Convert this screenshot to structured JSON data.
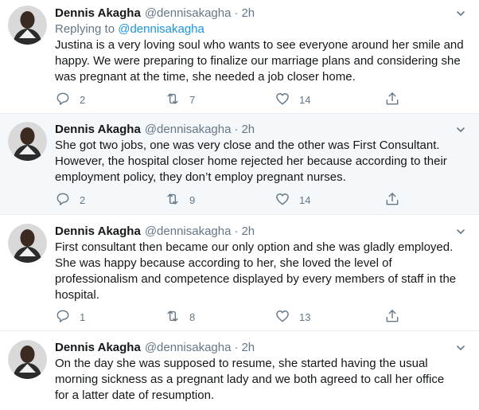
{
  "tweets": [
    {
      "name": "Dennis Akagha",
      "handle": "@dennisakagha",
      "separator": "·",
      "time": "2h",
      "replying_prefix": "Replying to",
      "replying_handle": "@dennisakagha",
      "lines": [
        "Justina is a very loving soul who wants to see everyone around her smile and",
        "happy. We were preparing to finalize our marriage plans and considering she",
        "was pregnant at the time, she needed a job closer home."
      ],
      "replies": "2",
      "retweets": "7",
      "likes": "14"
    },
    {
      "name": "Dennis Akagha",
      "handle": "@dennisakagha",
      "separator": "·",
      "time": "2h",
      "lines": [
        "She got two jobs, one was very close and the other was First Consultant.",
        "However, the hospital closer home rejected her because according to their",
        "employment policy, they don’t employ pregnant nurses."
      ],
      "replies": "2",
      "retweets": "9",
      "likes": "14"
    },
    {
      "name": "Dennis Akagha",
      "handle": "@dennisakagha",
      "separator": "·",
      "time": "2h",
      "lines": [
        "First consultant then became our only option and she was gladly employed.",
        "She was happy because according to her, she loved the level of",
        "professionalism and competence displayed by every members of staff in the",
        "hospital."
      ],
      "replies": "1",
      "retweets": "8",
      "likes": "13"
    },
    {
      "name": "Dennis Akagha",
      "handle": "@dennisakagha",
      "separator": "·",
      "time": "2h",
      "lines": [
        "On the day she was supposed to resume, she started having the usual",
        "morning sickness as a pregnant lady and we both agreed to call her office",
        "for a latter date of resumption."
      ]
    }
  ],
  "icons": {
    "reply": "reply-icon",
    "retweet": "retweet-icon",
    "like": "heart-icon",
    "share": "share-icon",
    "caret": "chevron-down-icon"
  },
  "colors": {
    "text": "#14171a",
    "secondary": "#657786",
    "link": "#1b95e0",
    "shaded_background": "#f5f8fa",
    "divider": "#e6ecf0"
  }
}
